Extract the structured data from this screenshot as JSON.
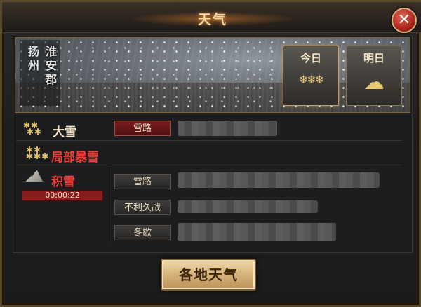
{
  "window": {
    "title": "天气",
    "close_label": "✕"
  },
  "banner": {
    "region_cols": [
      "扬州",
      "淮安郡"
    ],
    "days": [
      {
        "label": "今日",
        "icon": "snowflakes-icon",
        "glyph": "❄❄❄"
      },
      {
        "label": "明日",
        "icon": "cloud-icon",
        "glyph": "☁"
      }
    ]
  },
  "weather": [
    {
      "name": "大雪",
      "color": "#f0e2c4",
      "tag": "雪路",
      "tag_color": "#7a1e1e"
    },
    {
      "name": "局部暴雪",
      "color": "#e8423a"
    },
    {
      "name": "积雪",
      "color": "#e8423a",
      "timer": "00:00:22"
    }
  ],
  "effects": [
    {
      "label": "雪路"
    },
    {
      "label": "不利久战"
    },
    {
      "label": "冬歇"
    }
  ],
  "footer": {
    "button_label": "各地天气"
  },
  "colors": {
    "accent_gold": "#d6b27a",
    "danger_red": "#e8423a",
    "frame_gold": "#7a6540"
  }
}
